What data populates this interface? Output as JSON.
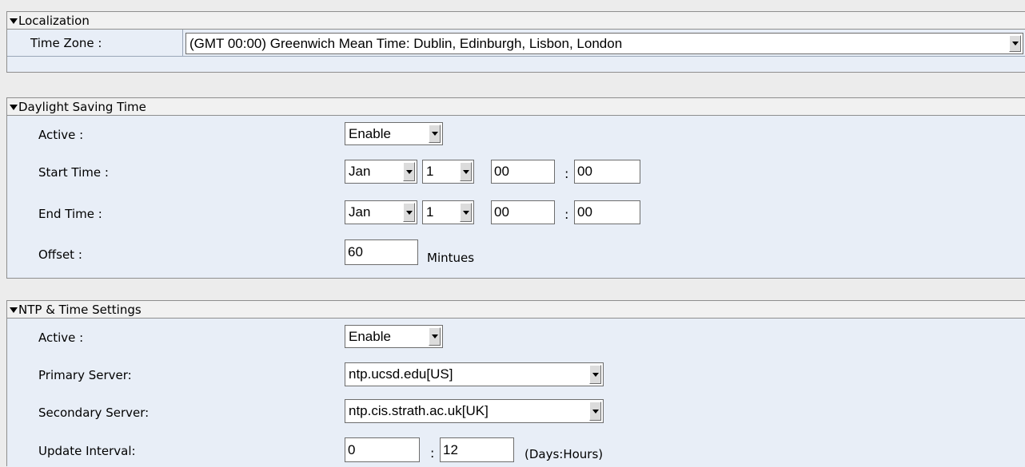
{
  "localization": {
    "header": "Localization",
    "time_zone_label": "Time Zone :",
    "time_zone_value": "(GMT 00:00) Greenwich Mean Time: Dublin, Edinburgh, Lisbon, London"
  },
  "dst": {
    "header": "Daylight Saving Time",
    "active_label": "Active :",
    "active_value": "Enable",
    "start_label": "Start Time :",
    "start_month": "Jan",
    "start_day": "1",
    "start_hour": "00",
    "start_min": "00",
    "end_label": "End Time :",
    "end_month": "Jan",
    "end_day": "1",
    "end_hour": "00",
    "end_min": "00",
    "offset_label": "Offset :",
    "offset_value": "60",
    "offset_unit": "Mintues",
    "colon": ":"
  },
  "ntp": {
    "header": "NTP & Time Settings",
    "active_label": "Active :",
    "active_value": "Enable",
    "primary_label": "Primary Server:",
    "primary_value": "ntp.ucsd.edu[US]",
    "secondary_label": "Secondary Server:",
    "secondary_value": "ntp.cis.strath.ac.uk[UK]",
    "interval_label": "Update Interval:",
    "interval_days": "0",
    "interval_hours": "12",
    "interval_unit": "(Days:Hours)",
    "colon": ":"
  }
}
